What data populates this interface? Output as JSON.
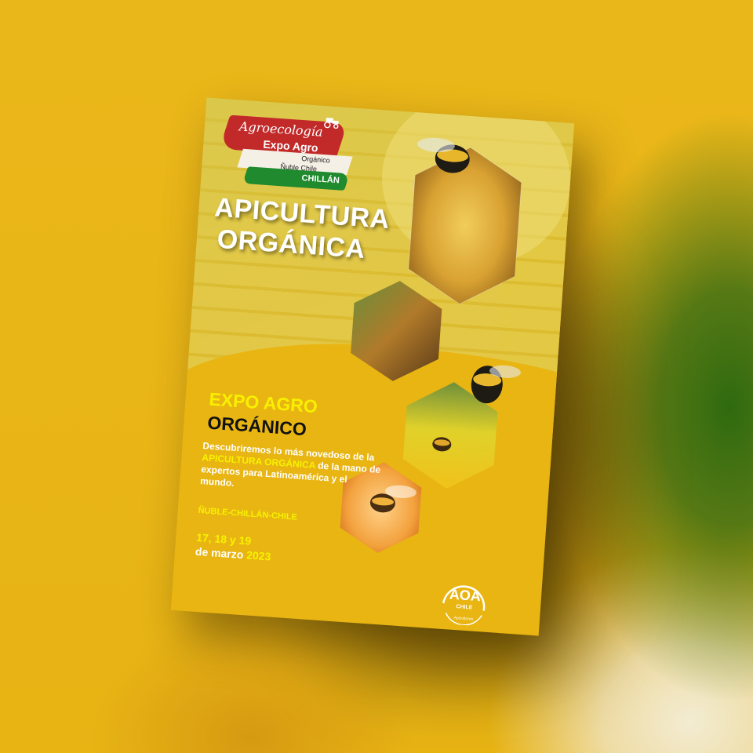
{
  "poster": {
    "logo": {
      "script": "Agroecología",
      "expo": "Expo Agro",
      "organico": "Orgánico",
      "region": "Ñuble Chile",
      "city": "CHILLÁN"
    },
    "title_line1": "APICULTURA",
    "title_line2": "ORGÁNICA",
    "heading1": "EXPO AGRO",
    "heading2": "ORGÁNICO",
    "description_part1": "Descubriremos lo más novedoso de la ",
    "description_highlight": "APICULTURA ORGÁNICA",
    "description_part2": " de la mano de expertos para Latinoamérica y el mundo.",
    "region_line": "ÑUBLE-CHILLÁN-CHILE",
    "dates": "17, 18 y 19",
    "date_month": "de marzo ",
    "date_year": "2023",
    "sponsor": {
      "name": "AOA",
      "country": "CHILE",
      "tag": "Apicultores"
    }
  },
  "colors": {
    "background": "#e8b414",
    "highlight_yellow": "#f7f200",
    "logo_red": "#c22a2a",
    "logo_green": "#1f8a2e"
  }
}
